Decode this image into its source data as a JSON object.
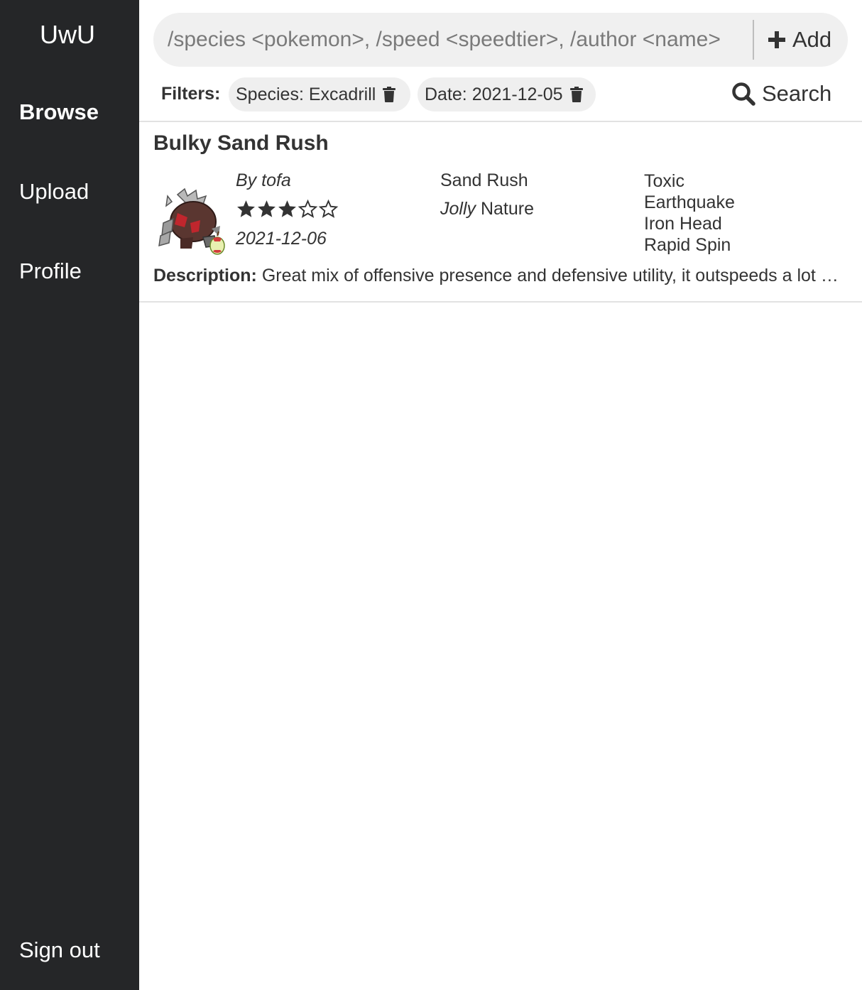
{
  "sidebar": {
    "brand": "UwU",
    "items": [
      {
        "label": "Browse",
        "active": true
      },
      {
        "label": "Upload",
        "active": false
      },
      {
        "label": "Profile",
        "active": false
      }
    ],
    "sign_out": "Sign out"
  },
  "search": {
    "placeholder": "/species <pokemon>, /speed <speedtier>, /author <name>",
    "value": "",
    "add_label": "Add",
    "add_icon": "plus-icon",
    "search_label": "Search",
    "search_icon": "magnifier-icon"
  },
  "filters": {
    "label": "Filters:",
    "chips": [
      {
        "text": "Species: Excadrill",
        "icon": "trash-icon"
      },
      {
        "text": "Date: 2021-12-05",
        "icon": "trash-icon"
      }
    ]
  },
  "results": [
    {
      "title": "Bulky Sand Rush",
      "author_line": "By tofa",
      "rating": 3,
      "rating_max": 5,
      "date": "2021-12-06",
      "ability": "Sand Rush",
      "nature": "Jolly",
      "nature_suffix": "Nature",
      "moves": [
        "Toxic",
        "Earthquake",
        "Iron Head",
        "Rapid Spin"
      ],
      "description_label": "Description:",
      "description": "Great mix of offensive presence and defensive utility, it outspeeds a lot of the metagame under sand"
    }
  ],
  "colors": {
    "sidebar_bg": "#252628",
    "text": "#333333",
    "chip_bg": "#efefef",
    "search_bg": "#f0f0f0"
  }
}
